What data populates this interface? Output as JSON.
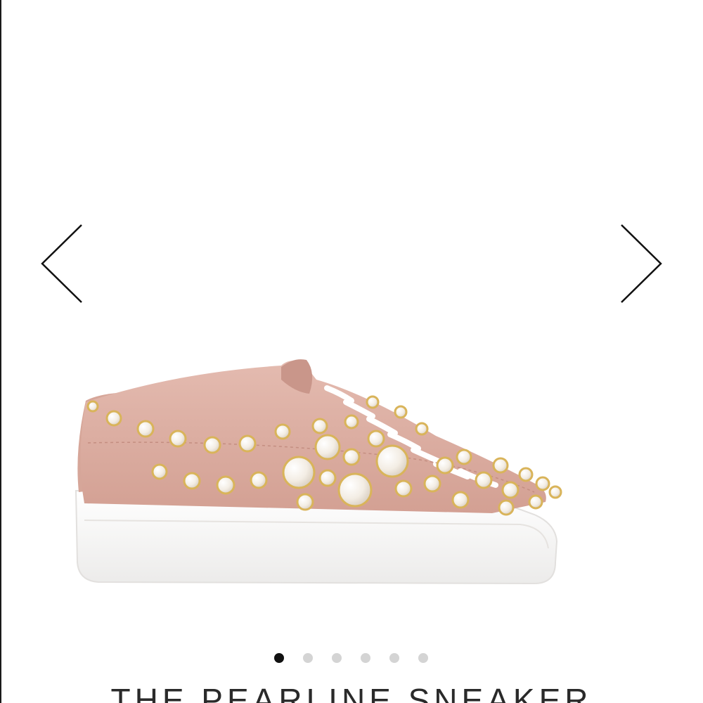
{
  "carousel": {
    "prev_icon": "chevron-left-icon",
    "next_icon": "chevron-right-icon",
    "image_subject": "pink-pearl-studded-sneaker",
    "dots_total": 6,
    "active_index": 0
  },
  "product": {
    "title": "THE PEARLINE SNEAKER"
  },
  "colors": {
    "upper": "#dcaea3",
    "sole": "#ffffff",
    "pearl": "#f5f0ea",
    "gold": "#d9b45a",
    "dot_active": "#111111",
    "dot_inactive": "#d4d4d4"
  }
}
